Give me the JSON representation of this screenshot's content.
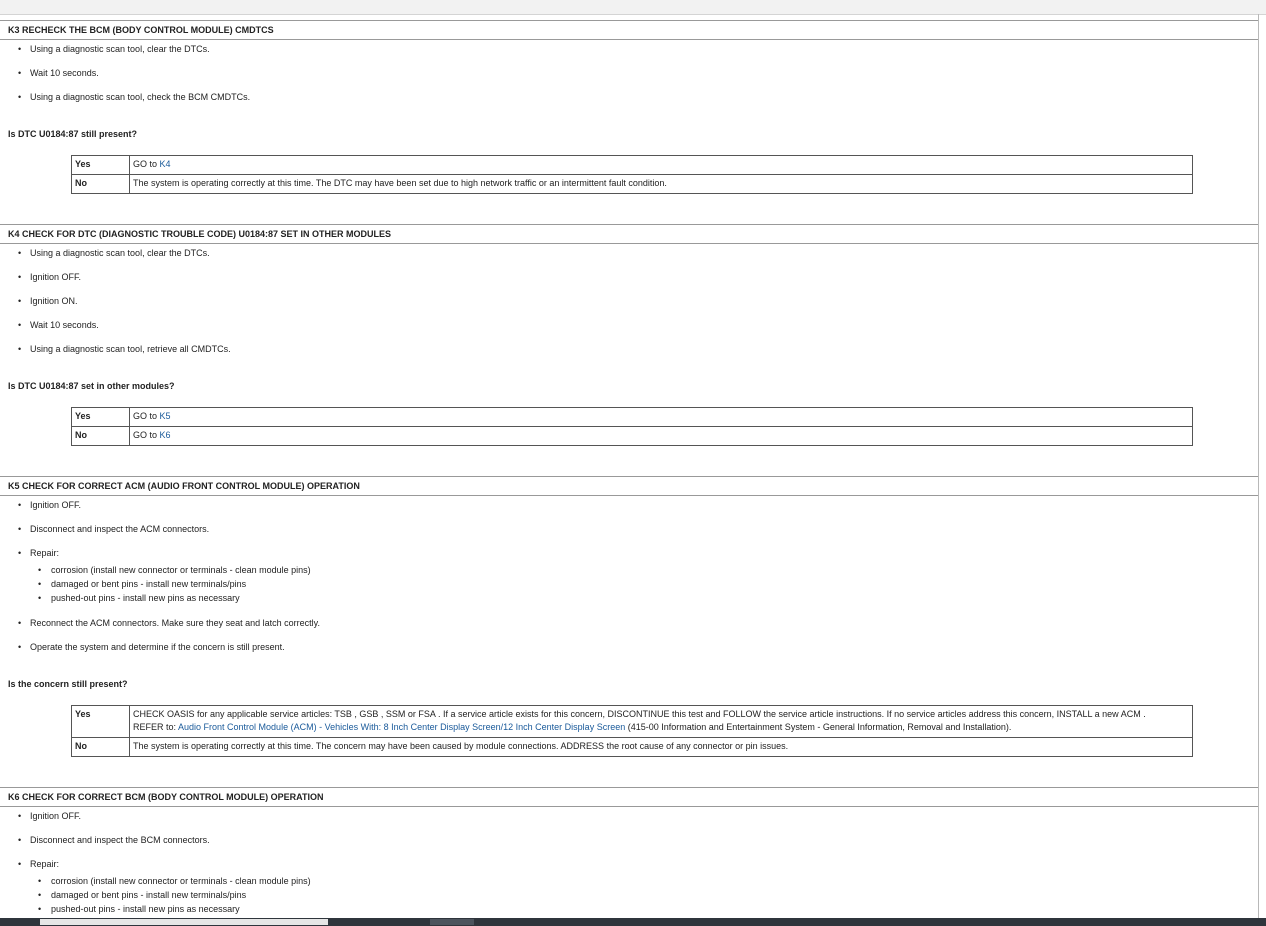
{
  "k3": {
    "title": "K3 RECHECK THE BCM (BODY CONTROL MODULE) CMDTCS",
    "actions": [
      "Using a diagnostic scan tool, clear the DTCs.",
      "Wait 10 seconds.",
      "Using a diagnostic scan tool, check the BCM CMDTCs."
    ],
    "question": "Is DTC U0184:87 still present?",
    "yes_label": "Yes",
    "yes_prefix": "GO to ",
    "yes_link": "K4",
    "no_label": "No",
    "no_text": "The system is operating correctly at this time. The DTC may have been set due to high network traffic or an intermittent fault condition."
  },
  "k4": {
    "title": "K4 CHECK FOR DTC (DIAGNOSTIC TROUBLE CODE) U0184:87 SET IN OTHER MODULES",
    "actions": [
      "Using a diagnostic scan tool, clear the DTCs.",
      "Ignition OFF.",
      "Ignition ON.",
      "Wait 10 seconds.",
      "Using a diagnostic scan tool, retrieve all CMDTCs."
    ],
    "question": "Is DTC U0184:87 set in other modules?",
    "yes_label": "Yes",
    "yes_prefix": "GO to ",
    "yes_link": "K5",
    "no_label": "No",
    "no_prefix": "GO to ",
    "no_link": "K6"
  },
  "k5": {
    "title": "K5 CHECK FOR CORRECT ACM (AUDIO FRONT CONTROL MODULE) OPERATION",
    "actions": {
      "a1": "Ignition OFF.",
      "a2": "Disconnect and inspect the ACM connectors.",
      "a3": "Repair:",
      "repair": [
        "corrosion (install new connector or terminals - clean module pins)",
        "damaged or bent pins - install new terminals/pins",
        "pushed-out pins - install new pins as necessary"
      ],
      "a4": "Reconnect the ACM connectors. Make sure they seat and latch correctly.",
      "a5": "Operate the system and determine if the concern is still present."
    },
    "question": "Is the concern still present?",
    "yes_label": "Yes",
    "yes_text_1": "CHECK OASIS for any applicable service articles: TSB , GSB , SSM or FSA . If a service article exists for this concern, DISCONTINUE this test and FOLLOW the service article instructions. If no service articles address this concern, INSTALL a new ACM .",
    "yes_refer": "REFER to: ",
    "yes_link": "Audio Front Control Module (ACM) - Vehicles With: 8 Inch Center Display Screen/12 Inch Center Display Screen",
    "yes_suffix": " (415-00 Information and Entertainment System - General Information, Removal and Installation).",
    "no_label": "No",
    "no_text": "The system is operating correctly at this time. The concern may have been caused by module connections. ADDRESS the root cause of any connector or pin issues."
  },
  "k6": {
    "title": "K6 CHECK FOR CORRECT BCM (BODY CONTROL MODULE) OPERATION",
    "actions": {
      "a1": "Ignition OFF.",
      "a2": "Disconnect and inspect the BCM connectors.",
      "a3": "Repair:",
      "repair": [
        "corrosion (install new connector or terminals - clean module pins)",
        "damaged or bent pins - install new terminals/pins",
        "pushed-out pins - install new pins as necessary"
      ]
    }
  }
}
